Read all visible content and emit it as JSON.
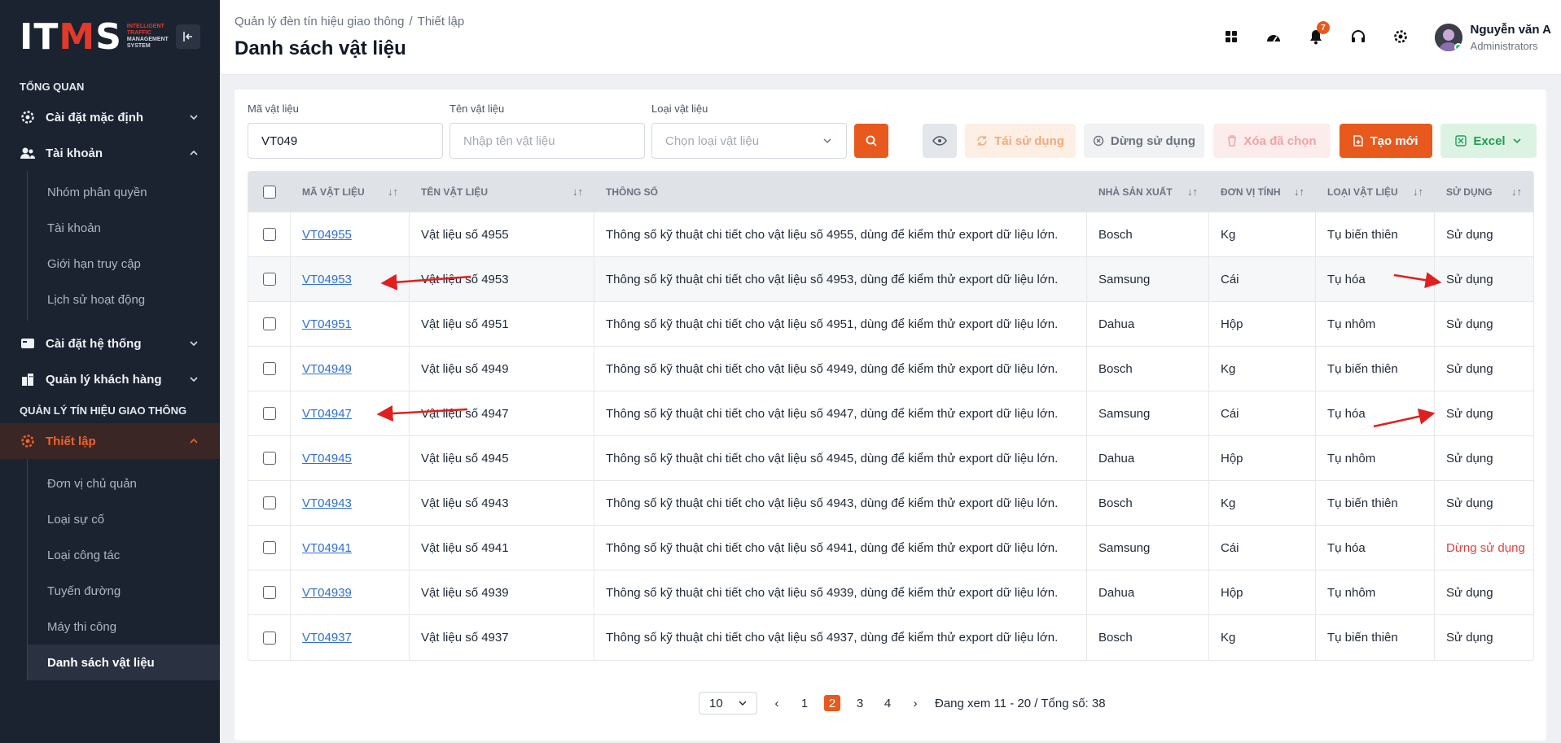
{
  "app": {
    "logo_main": "ITMS",
    "logo_sub_1": "INTELLIGENT",
    "logo_sub_2": "TRAFFIC",
    "logo_sub_3": "MANAGEMENT",
    "logo_sub_4": "SYSTEM"
  },
  "sidebar": {
    "section_overview": "TỔNG QUAN",
    "section_traffic": "QUẢN LÝ TÍN HIỆU GIAO THÔNG",
    "items": [
      {
        "label": "Cài đặt mặc định",
        "icon": "gear-icon"
      },
      {
        "label": "Tài khoản",
        "icon": "users-icon"
      },
      {
        "label": "Cài đặt hệ thống",
        "icon": "card-icon"
      },
      {
        "label": "Quản lý khách hàng",
        "icon": "building-icon"
      },
      {
        "label": "Thiết lập",
        "icon": "gear-icon"
      }
    ],
    "account_sub": [
      "Nhóm phân quyền",
      "Tài khoản",
      "Giới hạn truy cập",
      "Lịch sử hoạt động"
    ],
    "setup_sub": [
      "Đơn vị chủ quản",
      "Loại sự cố",
      "Loại công tác",
      "Tuyến đường",
      "Máy thi công",
      "Danh sách vật liệu"
    ]
  },
  "header": {
    "breadcrumb_1": "Quản lý đèn tín hiệu giao thông",
    "breadcrumb_sep": "/",
    "breadcrumb_2": "Thiết lập",
    "title": "Danh sách vật liệu",
    "notification_count": "7",
    "user_name": "Nguyễn văn A",
    "user_role": "Administrators"
  },
  "filters": {
    "code_label": "Mã vật liệu",
    "code_value": "VT049",
    "name_label": "Tên vật liệu",
    "name_placeholder": "Nhập tên vật liệu",
    "type_label": "Loại vật liệu",
    "type_placeholder": "Chọn loại vật liệu"
  },
  "actions": {
    "reuse": "Tái sử dụng",
    "stop": "Dừng sử dụng",
    "delete": "Xóa đã chọn",
    "create": "Tạo mới",
    "excel": "Excel"
  },
  "table": {
    "columns": [
      "MÃ VẬT LIỆU",
      "TÊN VẬT LIỆU",
      "THÔNG SỐ",
      "NHÀ SẢN XUẤT",
      "ĐƠN VỊ TÍNH",
      "LOẠI VẬT LIỆU",
      "SỬ DỤNG"
    ],
    "rows": [
      {
        "code": "VT04955",
        "name": "Vật liệu số 4955",
        "spec": "Thông số kỹ thuật chi tiết cho vật liệu số 4955, dùng để kiểm thử export dữ liệu lớn.",
        "maker": "Bosch",
        "unit": "Kg",
        "type": "Tụ biến thiên",
        "status": "Sử dụng"
      },
      {
        "code": "VT04953",
        "name": "Vật liệu số 4953",
        "spec": "Thông số kỹ thuật chi tiết cho vật liệu số 4953, dùng để kiểm thử export dữ liệu lớn.",
        "maker": "Samsung",
        "unit": "Cái",
        "type": "Tụ hóa",
        "status": "Sử dụng"
      },
      {
        "code": "VT04951",
        "name": "Vật liệu số 4951",
        "spec": "Thông số kỹ thuật chi tiết cho vật liệu số 4951, dùng để kiểm thử export dữ liệu lớn.",
        "maker": "Dahua",
        "unit": "Hộp",
        "type": "Tụ nhôm",
        "status": "Sử dụng"
      },
      {
        "code": "VT04949",
        "name": "Vật liệu số 4949",
        "spec": "Thông số kỹ thuật chi tiết cho vật liệu số 4949, dùng để kiểm thử export dữ liệu lớn.",
        "maker": "Bosch",
        "unit": "Kg",
        "type": "Tụ biến thiên",
        "status": "Sử dụng"
      },
      {
        "code": "VT04947",
        "name": "Vật liệu số 4947",
        "spec": "Thông số kỹ thuật chi tiết cho vật liệu số 4947, dùng để kiểm thử export dữ liệu lớn.",
        "maker": "Samsung",
        "unit": "Cái",
        "type": "Tụ hóa",
        "status": "Sử dụng"
      },
      {
        "code": "VT04945",
        "name": "Vật liệu số 4945",
        "spec": "Thông số kỹ thuật chi tiết cho vật liệu số 4945, dùng để kiểm thử export dữ liệu lớn.",
        "maker": "Dahua",
        "unit": "Hộp",
        "type": "Tụ nhôm",
        "status": "Sử dụng"
      },
      {
        "code": "VT04943",
        "name": "Vật liệu số 4943",
        "spec": "Thông số kỹ thuật chi tiết cho vật liệu số 4943, dùng để kiểm thử export dữ liệu lớn.",
        "maker": "Bosch",
        "unit": "Kg",
        "type": "Tụ biến thiên",
        "status": "Sử dụng"
      },
      {
        "code": "VT04941",
        "name": "Vật liệu số 4941",
        "spec": "Thông số kỹ thuật chi tiết cho vật liệu số 4941, dùng để kiểm thử export dữ liệu lớn.",
        "maker": "Samsung",
        "unit": "Cái",
        "type": "Tụ hóa",
        "status": "Dừng sử dụng"
      },
      {
        "code": "VT04939",
        "name": "Vật liệu số 4939",
        "spec": "Thông số kỹ thuật chi tiết cho vật liệu số 4939, dùng để kiểm thử export dữ liệu lớn.",
        "maker": "Dahua",
        "unit": "Hộp",
        "type": "Tụ nhôm",
        "status": "Sử dụng"
      },
      {
        "code": "VT04937",
        "name": "Vật liệu số 4937",
        "spec": "Thông số kỹ thuật chi tiết cho vật liệu số 4937, dùng để kiểm thử export dữ liệu lớn.",
        "maker": "Bosch",
        "unit": "Kg",
        "type": "Tụ biến thiên",
        "status": "Sử dụng"
      }
    ]
  },
  "pagination": {
    "page_size": "10",
    "pages": [
      "1",
      "2",
      "3",
      "4"
    ],
    "current": "2",
    "summary": "Đang xem 11 - 20 / Tổng số: 38"
  },
  "colors": {
    "accent": "#e8591d",
    "sidebar_bg": "#1b2230",
    "link": "#2f6fd6",
    "danger": "#e53e3e",
    "annotation_arrow": "#e02020"
  }
}
